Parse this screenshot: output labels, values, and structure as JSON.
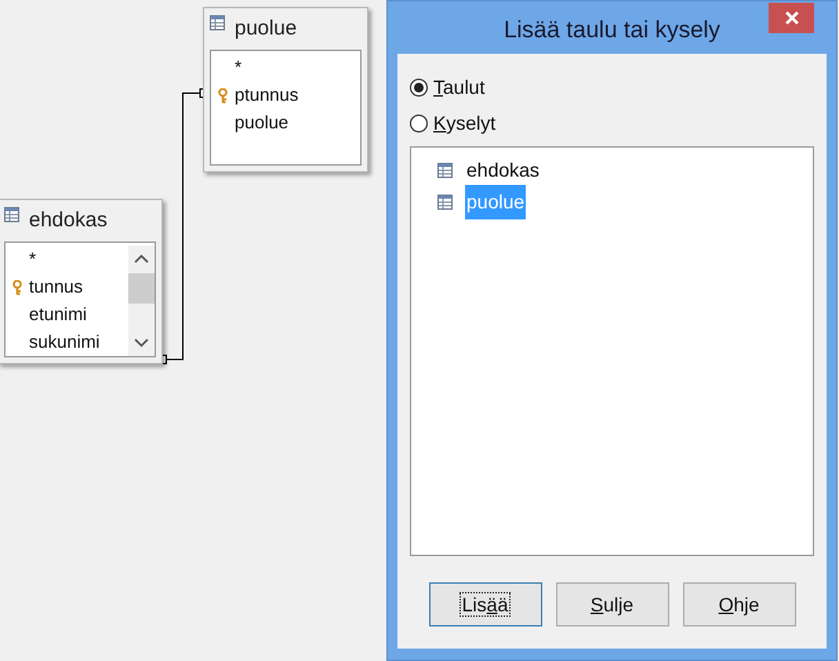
{
  "tables": [
    {
      "title": "puolue",
      "fields": [
        {
          "name": "*",
          "primary_key": false
        },
        {
          "name": "ptunnus",
          "primary_key": true
        },
        {
          "name": "puolue",
          "primary_key": false
        }
      ]
    },
    {
      "title": "ehdokas",
      "fields": [
        {
          "name": "*",
          "primary_key": false
        },
        {
          "name": "tunnus",
          "primary_key": true
        },
        {
          "name": "etunimi",
          "primary_key": false
        },
        {
          "name": "sukunimi",
          "primary_key": false
        }
      ]
    }
  ],
  "dialog": {
    "title": "Lisää taulu tai kysely",
    "radios": [
      {
        "key": "T",
        "after": "aulut",
        "selected": true
      },
      {
        "key": "K",
        "after": "yselyt",
        "selected": false
      }
    ],
    "items": [
      {
        "label": "ehdokas",
        "selected": false
      },
      {
        "label": "puolue",
        "selected": true
      }
    ],
    "buttons": [
      {
        "before": "Lis",
        "key": "ä",
        "after": "ä",
        "focused": true
      },
      {
        "key": "S",
        "after": "ulje",
        "focused": false
      },
      {
        "key": "O",
        "after": "hje",
        "focused": false
      }
    ]
  }
}
